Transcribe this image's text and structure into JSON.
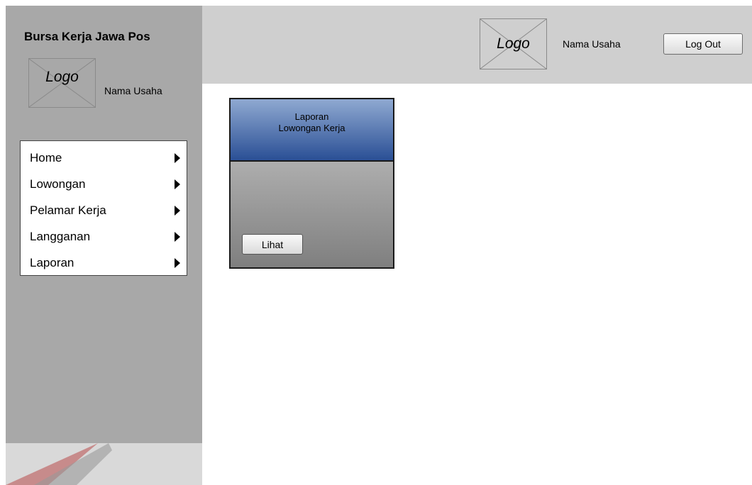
{
  "sidebar": {
    "app_title": "Bursa Kerja Jawa Pos",
    "logo_text": "Logo",
    "business_name": "Nama Usaha",
    "menu": [
      {
        "label": "Home",
        "icon": "arrow-right-icon"
      },
      {
        "label": "Lowongan",
        "icon": "arrow-right-icon"
      },
      {
        "label": "Pelamar Kerja",
        "icon": "arrow-right-icon"
      },
      {
        "label": "Langganan",
        "icon": "arrow-right-icon"
      },
      {
        "label": "Laporan",
        "icon": "arrow-right-icon"
      }
    ]
  },
  "header": {
    "logo_text": "Logo",
    "business_name": "Nama Usaha",
    "logout_label": "Log Out"
  },
  "card": {
    "title_line1": "Laporan",
    "title_line2": "Lowongan Kerja",
    "view_label": "Lihat"
  },
  "colors": {
    "sidebar_bg": "#a8a8a8",
    "header_bg": "#cfcfcf",
    "card_header_top": "#8fa9d1",
    "card_header_bottom": "#2a4f95"
  }
}
